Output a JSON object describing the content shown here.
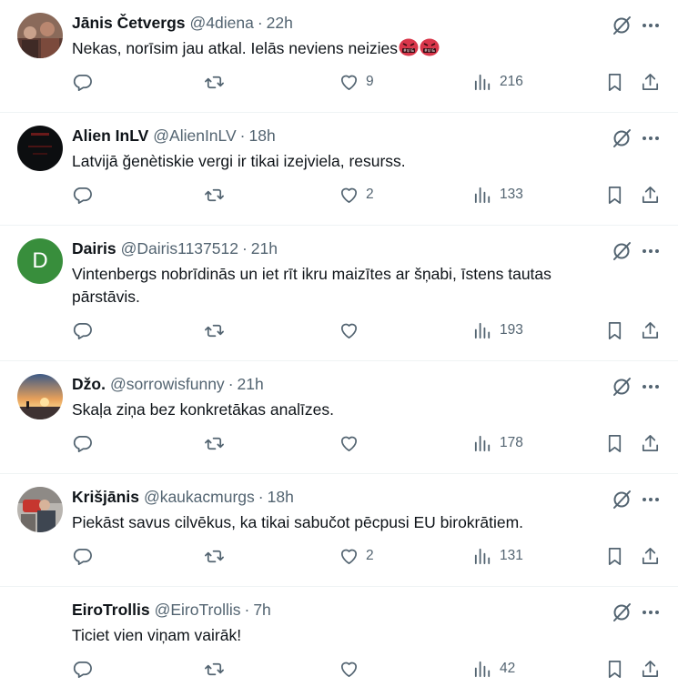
{
  "colors": {
    "text": "#0f1419",
    "secondary": "#536471",
    "border": "#eff3f4"
  },
  "icons": {
    "reply": "reply-icon",
    "retweet": "retweet-icon",
    "like": "heart-icon",
    "views": "views-icon",
    "bookmark": "bookmark-icon",
    "share": "share-icon",
    "grok": "grok-icon",
    "more": "more-icon"
  },
  "tweets": [
    {
      "name": "Jānis Četvergs",
      "handle": "@4diena",
      "sep": "·",
      "time": "22h",
      "text": "Nekas, norīsim jau atkal. Ielās neviens neizies",
      "emoji": [
        "angry-face-symbols",
        "angry-face-symbols"
      ],
      "reply_count": "",
      "retweet_count": "",
      "like_count": "9",
      "view_count": "216"
    },
    {
      "name": "Alien InLV",
      "handle": "@AlienInLV",
      "sep": "·",
      "time": "18h",
      "text": "Latvijā ğenètiskie vergi ir tikai izejviela, resurss.",
      "reply_count": "",
      "retweet_count": "",
      "like_count": "2",
      "view_count": "133"
    },
    {
      "name": "Dairis",
      "handle": "@Dairis1137512",
      "sep": "·",
      "time": "21h",
      "avatar_letter": "D",
      "text": "Vintenbergs nobrīdinās un iet rīt ikru maizītes ar šņabi, īstens tautas pārstāvis.",
      "reply_count": "",
      "retweet_count": "",
      "like_count": "",
      "view_count": "193"
    },
    {
      "name": "Džo.",
      "handle": "@sorrowisfunny",
      "sep": "·",
      "time": "21h",
      "text": "Skaļa ziņa bez konkretākas analīzes.",
      "reply_count": "",
      "retweet_count": "",
      "like_count": "",
      "view_count": "178"
    },
    {
      "name": "Krišjānis",
      "handle": "@kaukacmurgs",
      "sep": "·",
      "time": "18h",
      "text": "Piekāst savus cilvēkus, ka tikai sabučot pēcpusi EU birokrātiem.",
      "reply_count": "",
      "retweet_count": "",
      "like_count": "2",
      "view_count": "131"
    },
    {
      "name": "EiroTrollis",
      "handle": "@EiroTrollis",
      "sep": "·",
      "time": "7h",
      "text": "Ticiet vien viņam vairāk!",
      "reply_count": "",
      "retweet_count": "",
      "like_count": "",
      "view_count": "42"
    }
  ]
}
